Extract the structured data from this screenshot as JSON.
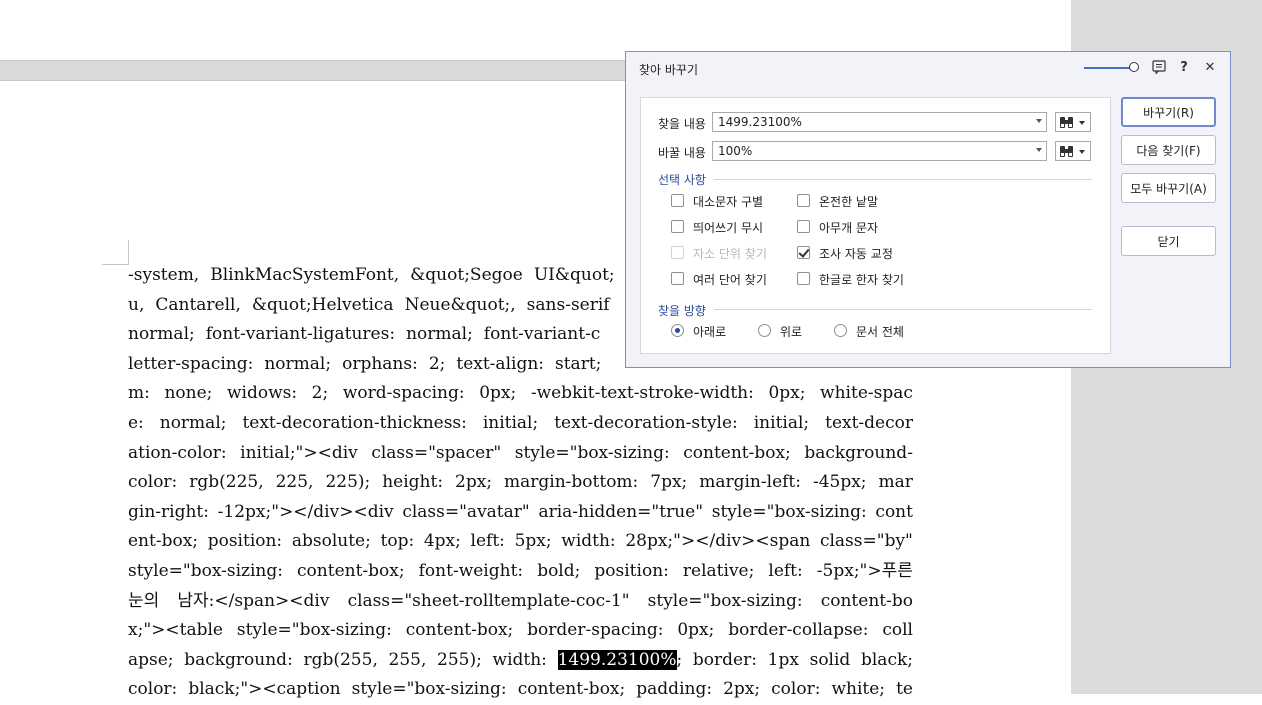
{
  "document": {
    "lines": [
      [
        "-system,",
        "BlinkMacSystemFont,",
        "&quot;Segoe",
        "UI&quot;"
      ],
      [
        "u,",
        "Cantarell,",
        "&quot;Helvetica",
        "Neue&quot;,",
        "sans-serif"
      ],
      [
        "normal;",
        "font-variant-ligatures:",
        "normal;",
        "font-variant-c"
      ],
      [
        "letter-spacing:",
        "normal;",
        "orphans:",
        "2;",
        "text-align:",
        "start;"
      ],
      [
        "m:",
        "none;",
        "widows:",
        "2;",
        "word-spacing:",
        "0px;",
        "-webkit-text-stroke-width:",
        "0px;",
        "white-spac"
      ],
      [
        "e:",
        "normal;",
        "text-decoration-thickness:",
        "initial;",
        "text-decoration-style:",
        "initial;",
        "text-decor"
      ],
      [
        "ation-color:",
        "initial;\"><div",
        "class=\"spacer\"",
        "style=\"box-sizing:",
        "content-box;",
        "background-"
      ],
      [
        "color:",
        "rgb(225,",
        "225,",
        "225);",
        "height:",
        "2px;",
        "margin-bottom:",
        "7px;",
        "margin-left:",
        "-45px;",
        "mar"
      ],
      [
        "gin-right:",
        "-12px;\"></div><div",
        "class=\"avatar\"",
        "aria-hidden=\"true\"",
        "style=\"box-sizing:",
        "cont"
      ],
      [
        "ent-box;",
        "position:",
        "absolute;",
        "top:",
        "4px;",
        "left:",
        "5px;",
        "width:",
        "28px;\"></div><span",
        "class=\"by\""
      ],
      [
        "style=\"box-sizing:",
        "content-box;",
        "font-weight:",
        "bold;",
        "position:",
        "relative;",
        "left:",
        "-5px;\">푸른"
      ],
      [
        "눈의",
        "남자:</span><div",
        "class=\"sheet-rolltemplate-coc-1\"",
        "style=\"box-sizing:",
        "content-bo"
      ],
      [
        "x;\"><table",
        "style=\"box-sizing:",
        "content-box;",
        "border-spacing:",
        "0px;",
        "border-collapse:",
        "coll"
      ],
      [
        "apse;",
        "background:",
        "rgb(255,",
        "255,",
        "255);",
        "width:",
        "@@HL@@",
        "border:",
        "1px",
        "solid",
        "black;"
      ],
      [
        "color:",
        "black;\"><caption",
        "style=\"box-sizing:",
        "content-box;",
        "padding:",
        "2px;",
        "color:",
        "white;",
        "te"
      ]
    ],
    "highlight": "1499.23100%",
    "highlight_suffix": ";"
  },
  "dialog": {
    "title": "찾아 바꾸기",
    "icons": {
      "memo": "memo-icon",
      "help": "?",
      "close": "✕"
    },
    "find_label": "찾을 내용",
    "find_value": "1499.23100%",
    "replace_label": "바꿀 내용",
    "replace_value": "100%",
    "options_title": "선택 사항",
    "options": [
      {
        "label": "대소문자 구별",
        "checked": false,
        "disabled": false
      },
      {
        "label": "온전한 낱말",
        "checked": false,
        "disabled": false
      },
      {
        "label": "띄어쓰기 무시",
        "checked": false,
        "disabled": false
      },
      {
        "label": "아무개 문자",
        "checked": false,
        "disabled": false
      },
      {
        "label": "자소 단위 찾기",
        "checked": false,
        "disabled": true
      },
      {
        "label": "조사 자동 교정",
        "checked": true,
        "disabled": false
      },
      {
        "label": "여러 단어 찾기",
        "checked": false,
        "disabled": false
      },
      {
        "label": "한글로 한자 찾기",
        "checked": false,
        "disabled": false
      }
    ],
    "direction_title": "찾을 방향",
    "directions": [
      {
        "label": "아래로",
        "selected": true
      },
      {
        "label": "위로",
        "selected": false
      },
      {
        "label": "문서 전체",
        "selected": false
      }
    ],
    "buttons": {
      "replace": "바꾸기(R)",
      "find_next": "다음 찾기(F)",
      "replace_all": "모두 바꾸기(A)",
      "close": "닫기"
    }
  },
  "colors": {
    "accent": "#2c4a9a",
    "dialog_border": "#7a8fc7",
    "highlight_bg": "#000000"
  }
}
